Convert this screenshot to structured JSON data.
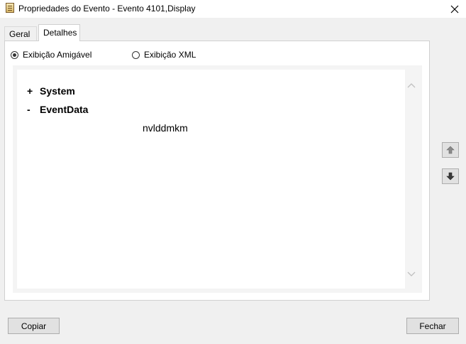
{
  "window": {
    "title": "Propriedades do Evento - Evento 4101,Display",
    "app_icon": "event-viewer-icon",
    "close_icon": "close-icon"
  },
  "tabs": [
    {
      "label": "Geral",
      "selected": false
    },
    {
      "label": "Detalhes",
      "selected": true
    }
  ],
  "view_options": {
    "friendly": {
      "label": "Exibição Amigável",
      "checked": true
    },
    "xml": {
      "label": "Exibição XML",
      "checked": false
    }
  },
  "tree": {
    "system": {
      "sign": "+",
      "label": "System"
    },
    "eventdata": {
      "sign": "-",
      "label": "EventData",
      "value": "nvlddmkm"
    }
  },
  "side_buttons": {
    "up_icon": "arrow-up-icon",
    "down_icon": "arrow-down-icon"
  },
  "footer": {
    "copy_label": "Copiar",
    "close_label": "Fechar"
  }
}
